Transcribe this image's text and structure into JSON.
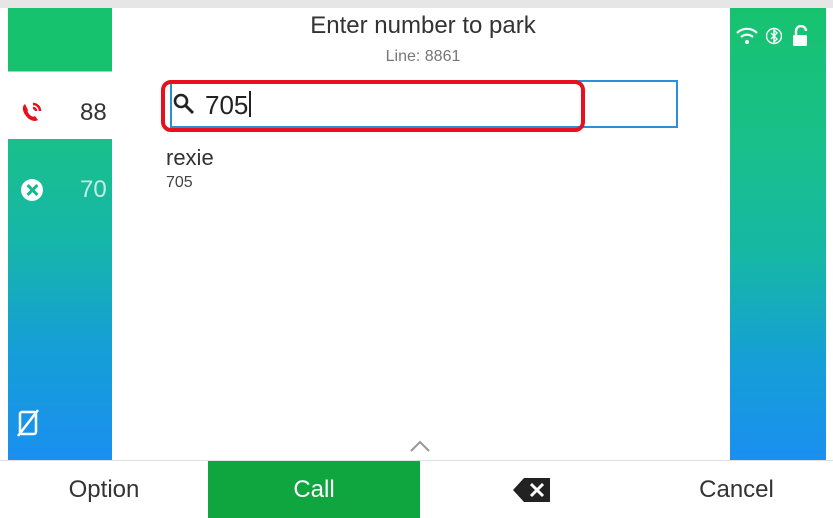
{
  "popup": {
    "title": "Enter number to park",
    "subtitle": "Line: 8861",
    "search": {
      "value": "705"
    },
    "result": {
      "name": "rexie",
      "number": "705"
    }
  },
  "left_panel": {
    "row1_number": "88",
    "row2_number": "70"
  },
  "softkeys": {
    "option": "Option",
    "call": "Call",
    "cancel": "Cancel"
  },
  "colors": {
    "call_green": "#10a63f",
    "highlight_red": "#e8101d",
    "search_border": "#2a8fd8",
    "panel_green": "#17c26e",
    "panel_blue": "#1a8ff0"
  },
  "icons": [
    "phone-ringing-icon",
    "cancel-circle-icon",
    "no-phone-icon",
    "wifi-icon",
    "bluetooth-icon",
    "unlock-icon",
    "search-icon",
    "chevron-up-icon",
    "backspace-icon"
  ]
}
